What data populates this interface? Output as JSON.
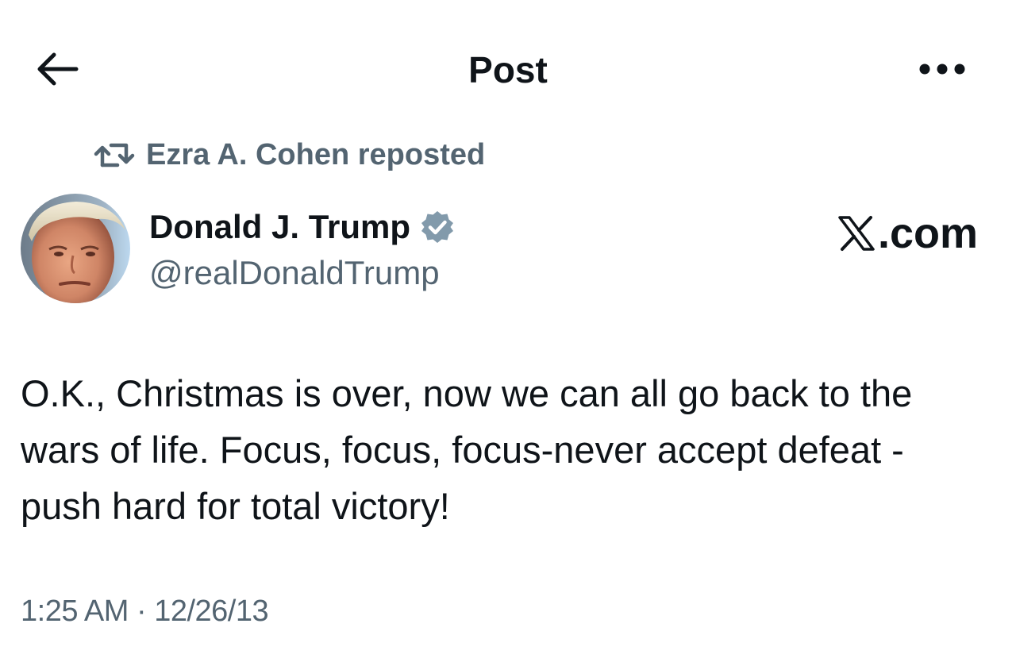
{
  "header": {
    "title": "Post",
    "back_icon": "arrow-left-icon",
    "more_icon": "more-horizontal-icon"
  },
  "repost": {
    "icon": "repost-icon",
    "text": "Ezra A. Cohen reposted"
  },
  "author": {
    "name": "Donald J. Trump",
    "handle": "@realDonaldTrump",
    "verified": true,
    "verified_icon": "verified-badge-icon",
    "avatar": "profile-photo"
  },
  "watermark": {
    "text": ".com",
    "logo": "x-logo-icon"
  },
  "post": {
    "text": "O.K., Christmas is over, now we can all go back to the wars of life. Focus, focus, focus-never accept defeat -push hard for total victory!",
    "timestamp": "1:25 AM · 12/26/13"
  },
  "colors": {
    "primary_text": "#0f1419",
    "secondary_text": "#536471",
    "verified_badge": "#829aab",
    "background": "#ffffff"
  }
}
